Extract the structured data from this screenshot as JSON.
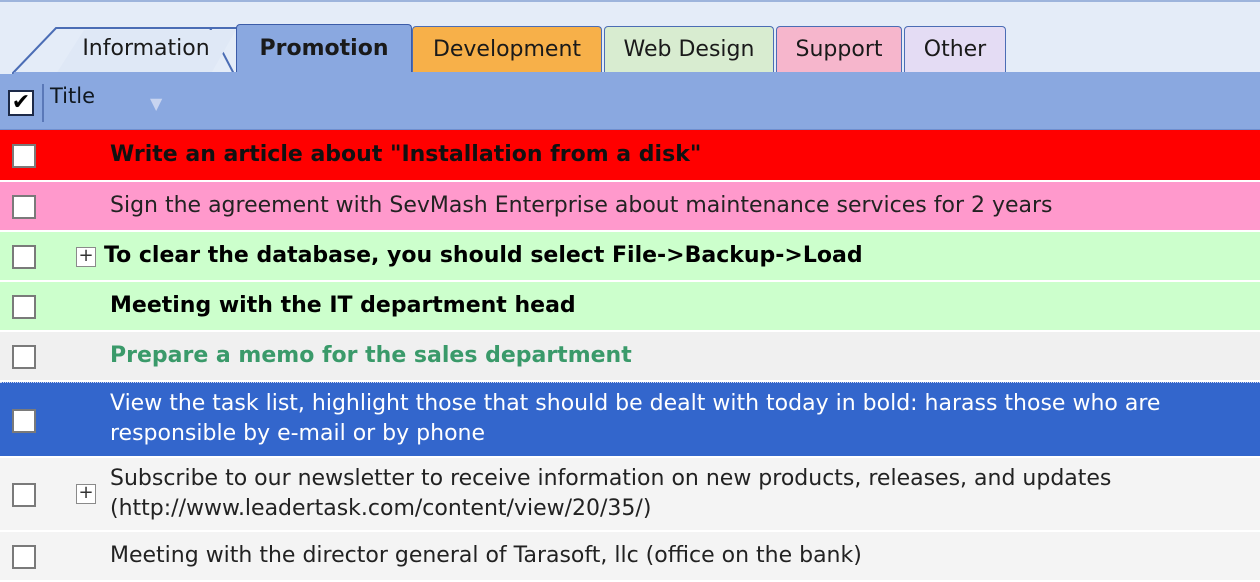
{
  "tabs": [
    {
      "label": "Information"
    },
    {
      "label": "Promotion"
    },
    {
      "label": "Development"
    },
    {
      "label": "Web Design"
    },
    {
      "label": "Support"
    },
    {
      "label": "Other"
    }
  ],
  "active_tab": "Promotion",
  "header": {
    "title": "Title",
    "filter_icon": "filter-icon"
  },
  "tasks": [
    {
      "text": "Write an article about \"Installation from a disk\"",
      "bg": "#ff0000",
      "color": "#111111",
      "bold": true
    },
    {
      "text": "Sign the agreement with SevMash Enterprise about maintenance services for 2 years",
      "bg": "#ff99cc",
      "color": "#222222",
      "bold": false
    },
    {
      "text": "To clear the database, you should select File->Backup->Load",
      "bg": "#ccffcc",
      "color": "#000000",
      "bold": true
    },
    {
      "text": "Meeting with the IT department head",
      "bg": "#ccffcc",
      "color": "#000000",
      "bold": true
    },
    {
      "text": "Prepare a memo for the sales department",
      "bg": "#f0f0f0",
      "color": "#3a9a6a",
      "bold": true
    },
    {
      "text_line1": "View the task list, highlight those that should be dealt with today in bold: harass those who are",
      "text_line2": "responsible by e-mail or by phone",
      "bg": "#3366cc",
      "color": "#ffffff",
      "bold": false
    },
    {
      "text_line1": "Subscribe to our newsletter to receive information on new products, releases, and updates",
      "text_line2": "(http://www.leadertask.com/content/view/20/35/)",
      "bg": "#f4f4f4",
      "color": "#222222",
      "bold": false
    },
    {
      "text": "Meeting with the director general of Tarasoft, llc (office on the bank)",
      "bg": "#f4f4f4",
      "color": "#222222",
      "bold": false
    }
  ]
}
